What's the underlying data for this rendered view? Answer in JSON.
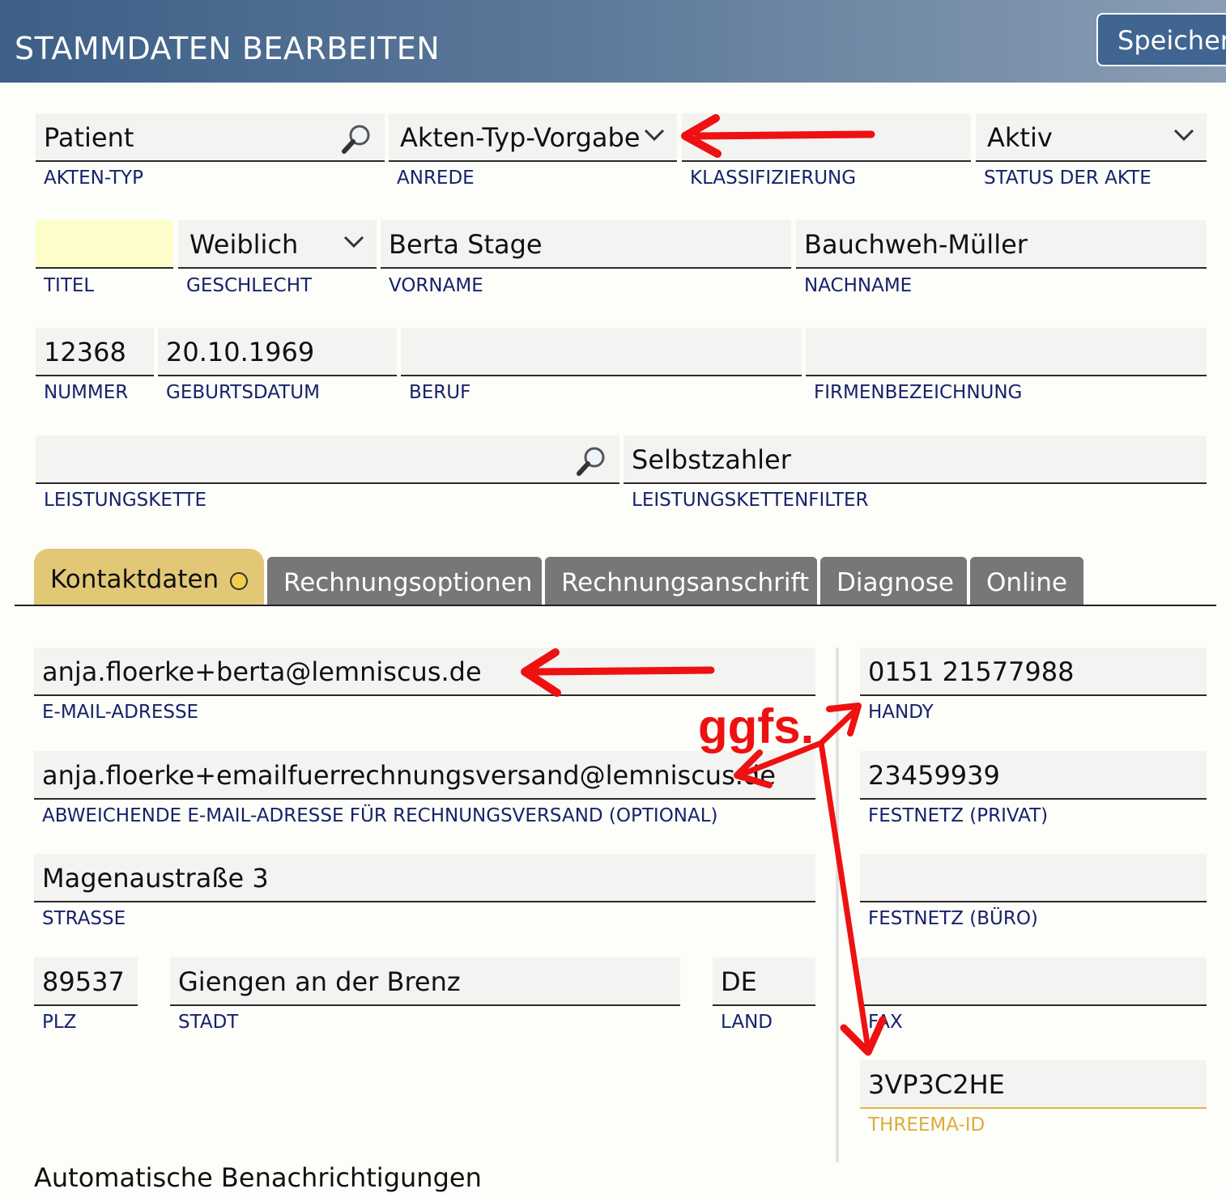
{
  "header": {
    "title": "STAMMDATEN BEARBEITEN",
    "save_label": "Speichern"
  },
  "row1": {
    "akten_typ": {
      "value": "Patient",
      "label": "AKTEN-TYP"
    },
    "anrede": {
      "value": "Akten-Typ-Vorgabe",
      "label": "ANREDE"
    },
    "klassifizierung": {
      "value": "",
      "label": "KLASSIFIZIERUNG"
    },
    "status": {
      "value": "Aktiv",
      "label": "STATUS DER AKTE"
    }
  },
  "row2": {
    "titel": {
      "value": "",
      "label": "TITEL"
    },
    "geschlecht": {
      "value": "Weiblich",
      "label": "GESCHLECHT"
    },
    "vorname": {
      "value": "Berta Stage",
      "label": "VORNAME"
    },
    "nachname": {
      "value": "Bauchweh-Müller",
      "label": "NACHNAME"
    }
  },
  "row3": {
    "nummer": {
      "value": "12368",
      "label": "NUMMER"
    },
    "geburtsdatum": {
      "value": "20.10.1969",
      "label": "GEBURTSDATUM"
    },
    "beruf": {
      "value": "",
      "label": "BERUF"
    },
    "firma": {
      "value": "",
      "label": "FIRMENBEZEICHNUNG"
    }
  },
  "row4": {
    "leistungskette": {
      "value": "",
      "label": "LEISTUNGSKETTE"
    },
    "filter": {
      "value": "Selbstzahler",
      "label": "LEISTUNGSKETTENFILTER"
    }
  },
  "tabs": [
    {
      "label": "Kontaktdaten"
    },
    {
      "label": "Rechnungsoptionen"
    },
    {
      "label": "Rechnungsanschrift"
    },
    {
      "label": "Diagnose"
    },
    {
      "label": "Online"
    }
  ],
  "contact": {
    "email": {
      "value": "anja.floerke+berta@lemniscus.de",
      "label": "E-MAIL-ADRESSE"
    },
    "email_invoice": {
      "value": "anja.floerke+emailfuerrechnungsversand@lemniscus.de",
      "label": "ABWEICHENDE E-MAIL-ADRESSE FÜR RECHNUNGSVERSAND (OPTIONAL)"
    },
    "strasse": {
      "value": "Magenaustraße 3",
      "label": "STRASSE"
    },
    "plz": {
      "value": "89537",
      "label": "PLZ"
    },
    "stadt": {
      "value": "Giengen an der Brenz",
      "label": "STADT"
    },
    "land": {
      "value": "DE",
      "label": "LAND"
    },
    "handy": {
      "value": "0151 21577988",
      "label": "HANDY"
    },
    "festnetz_privat": {
      "value": "23459939",
      "label": "FESTNETZ (PRIVAT)"
    },
    "festnetz_buero": {
      "value": "",
      "label": "FESTNETZ (BÜRO)"
    },
    "fax": {
      "value": "",
      "label": "FAX"
    },
    "threema": {
      "value": "3VP3C2HE",
      "label": "THREEMA-ID"
    }
  },
  "footer": {
    "partial_text": "Automatische Benachrichtigungen"
  },
  "annotation": {
    "text": "ggfs."
  },
  "colors": {
    "label": "#16226a",
    "accent": "#e2c776",
    "annotation": "#ee1111"
  }
}
